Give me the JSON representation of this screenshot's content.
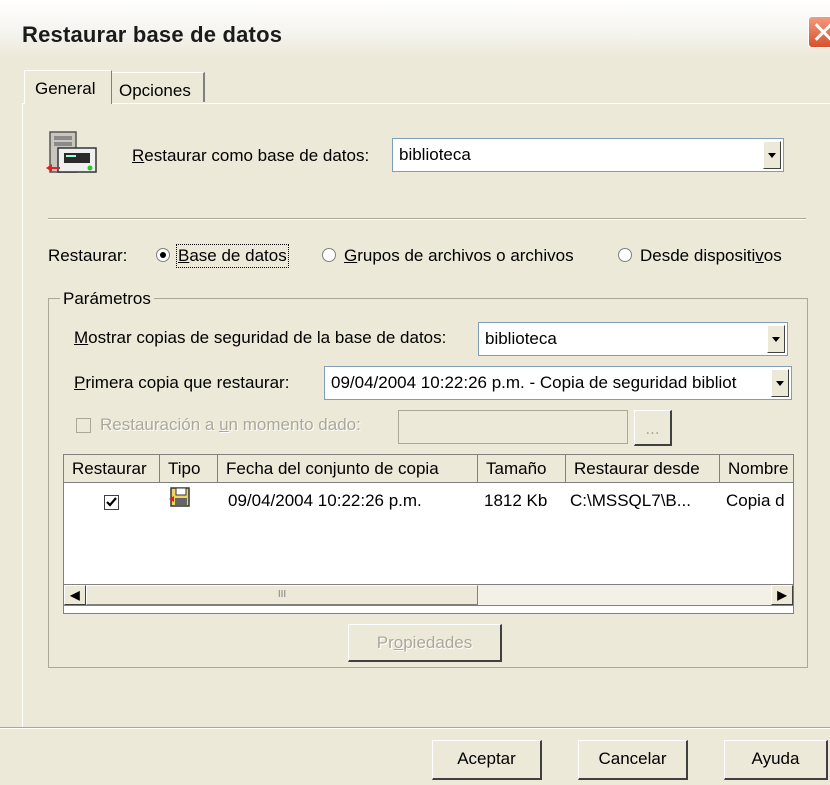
{
  "window": {
    "title": "Restaurar base de datos"
  },
  "tabs": [
    {
      "label": "General",
      "active": true
    },
    {
      "label": "Opciones",
      "active": false
    }
  ],
  "restore_as": {
    "label_accel": "R",
    "label_rest": "estaurar como base de datos:",
    "value": "biblioteca"
  },
  "restore_type": {
    "label": "Restaurar:",
    "options": [
      {
        "accel": "B",
        "rest": "ase de datos",
        "selected": true
      },
      {
        "accel": "G",
        "rest": "rupos de archivos o archivos",
        "selected": false
      },
      {
        "pre": "Desde dispositi",
        "accel": "v",
        "post": "os",
        "selected": false
      }
    ]
  },
  "parameters": {
    "group_title": "Parámetros",
    "show_backups": {
      "accel": "M",
      "rest": "ostrar copias de seguridad de la base de datos:",
      "value": "biblioteca"
    },
    "first_backup": {
      "accel": "P",
      "rest": "rimera copia que restaurar:",
      "value": "09/04/2004 10:22:26 p.m. - Copia de seguridad bibliot"
    },
    "point_in_time": {
      "pre": "Restauración a ",
      "accel": "u",
      "post": "n momento dado:",
      "checked": false,
      "enabled": false,
      "value": "",
      "browse_label": "..."
    }
  },
  "backup_table": {
    "columns": [
      "Restaurar",
      "Tipo",
      "Fecha del conjunto de copia",
      "Tamaño",
      "Restaurar desde",
      "Nombre"
    ],
    "rows": [
      {
        "restore": true,
        "type_icon": "full-backup-icon",
        "date": "09/04/2004 10:22:26 p.m.",
        "size": "1812 Kb",
        "from": "C:\\MSSQL7\\B...",
        "name": "Copia d"
      }
    ],
    "scroll_thumb_grip": "III"
  },
  "properties_button": {
    "accel_pre": "Pr",
    "accel": "o",
    "post": "piedades",
    "enabled": false
  },
  "buttons": {
    "ok": "Aceptar",
    "cancel": "Cancelar",
    "help": "Ayuda"
  },
  "colors": {
    "face": "#ece9d8",
    "border_blue": "#7f9db9",
    "close_red": "#d8502c"
  }
}
